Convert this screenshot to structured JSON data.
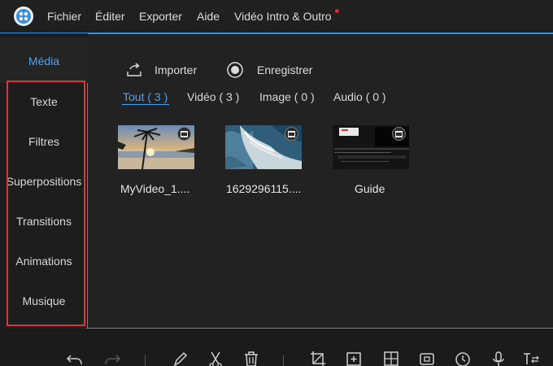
{
  "menubar": {
    "items": [
      {
        "label": "Fichier"
      },
      {
        "label": "Éditer"
      },
      {
        "label": "Exporter"
      },
      {
        "label": "Aide"
      },
      {
        "label": "Vidéo Intro & Outro"
      }
    ]
  },
  "sidebar": {
    "active_tab": "Média",
    "items": [
      {
        "label": "Texte"
      },
      {
        "label": "Filtres"
      },
      {
        "label": "Superpositions"
      },
      {
        "label": "Transitions"
      },
      {
        "label": "Animations"
      },
      {
        "label": "Musique"
      }
    ]
  },
  "actions": {
    "import_label": "Importer",
    "record_label": "Enregistrer"
  },
  "filters": [
    {
      "label": "Tout ( 3 )",
      "active": true
    },
    {
      "label": "Vidéo ( 3 )",
      "active": false
    },
    {
      "label": "Image ( 0 )",
      "active": false
    },
    {
      "label": "Audio ( 0 )",
      "active": false
    }
  ],
  "media": [
    {
      "label": "MyVideo_1...."
    },
    {
      "label": "1629296115...."
    },
    {
      "label": "Guide"
    }
  ],
  "bottom_toolbar": {
    "tools": [
      "undo-icon",
      "redo-icon",
      "pencil-icon",
      "scissors-icon",
      "trash-icon",
      "crop-icon",
      "add-frame-icon",
      "grid-icon",
      "freeze-frame-icon",
      "clock-icon",
      "microphone-icon",
      "text-adjust-icon"
    ]
  },
  "colors": {
    "accent": "#4ea3ec",
    "highlight": "#e0353a",
    "background": "#222222"
  }
}
